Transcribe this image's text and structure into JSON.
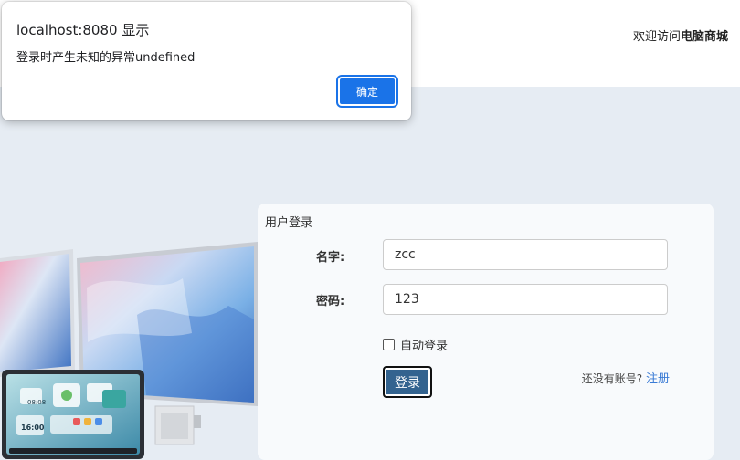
{
  "dialog": {
    "title": "localhost:8080 显示",
    "message": "登录时产生未知的异常undefined",
    "ok_label": "确定"
  },
  "header": {
    "welcome_prefix": "欢迎访问",
    "site_name": "电脑商城"
  },
  "login": {
    "title": "用户登录",
    "name_label": "名字:",
    "name_value": "zcc",
    "password_label": "密码:",
    "password_value": "123",
    "remember_label": "自动登录",
    "remember_checked": false,
    "submit_label": "登录",
    "no_account_text": "还没有账号?",
    "register_link": "注册"
  },
  "hero": {
    "tablet_time": "16:00",
    "tablet_small_time": "08:08"
  },
  "colors": {
    "page_background": "#e6ecf3",
    "dialog_accent": "#1a73e8",
    "login_button": "#33638f",
    "link": "#3a7bd5"
  }
}
